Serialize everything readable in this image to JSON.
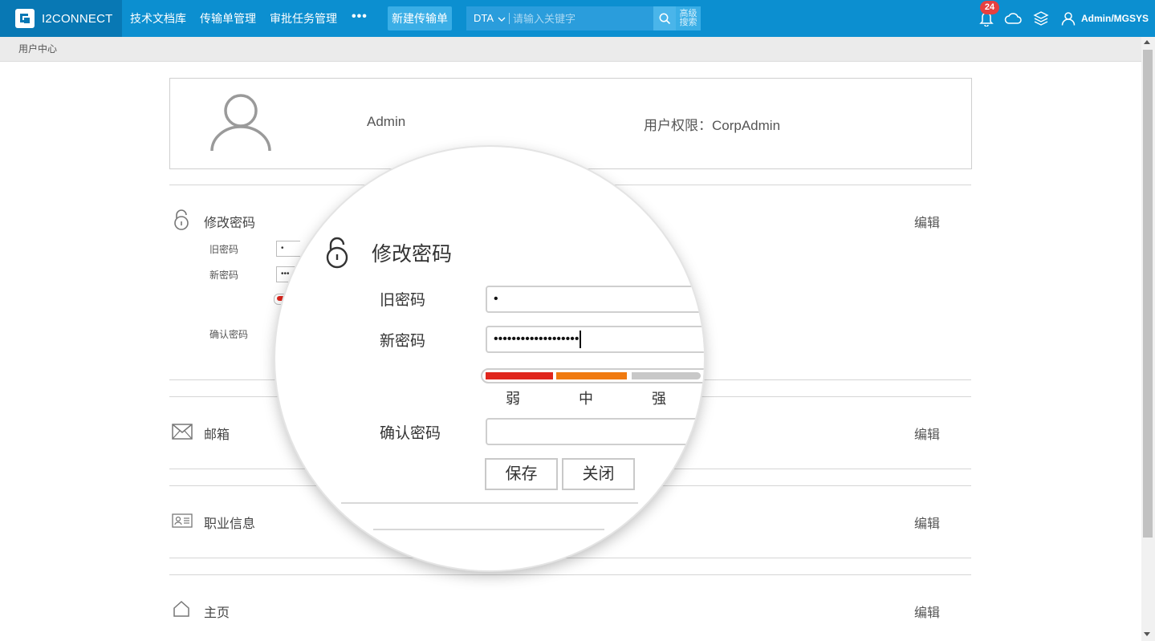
{
  "header": {
    "logo_text": "I2CONNECT",
    "nav": [
      "技术文档库",
      "传输单管理",
      "审批任务管理"
    ],
    "more": "•••",
    "new_button": "新建传输单",
    "search_scope": "DTA",
    "search_placeholder": "请输入关键字",
    "advanced_line1": "高级",
    "advanced_line2": "搜索",
    "notification_count": "24",
    "user": "Admin/MGSYS"
  },
  "breadcrumb": "用户中心",
  "profile": {
    "name": "Admin",
    "role": "用户权限：CorpAdmin"
  },
  "sections": {
    "password": {
      "title": "修改密码",
      "edit": "编辑",
      "old_label": "旧密码",
      "new_label": "新密码",
      "confirm_label": "确认密码",
      "old_value": "•",
      "new_value": "•••"
    },
    "email": {
      "title": "邮箱",
      "edit": "编辑"
    },
    "career": {
      "title": "职业信息",
      "edit": "编辑"
    },
    "home": {
      "title": "主页",
      "edit": "编辑"
    }
  },
  "magnifier": {
    "title": "修改密码",
    "old_label": "旧密码",
    "new_label": "新密码",
    "confirm_label": "确认密码",
    "old_value": "•",
    "new_value": "•••••••••••••••••••",
    "strength_labels": [
      "弱",
      "中",
      "强"
    ],
    "strength_colors": [
      "#e0261d",
      "#f07a10",
      "#c8c8c8"
    ],
    "save": "保存",
    "close": "关闭"
  },
  "colors": {
    "topbar": "#0c8fd0",
    "logo_block": "#0878b4",
    "badge": "#e74040"
  }
}
